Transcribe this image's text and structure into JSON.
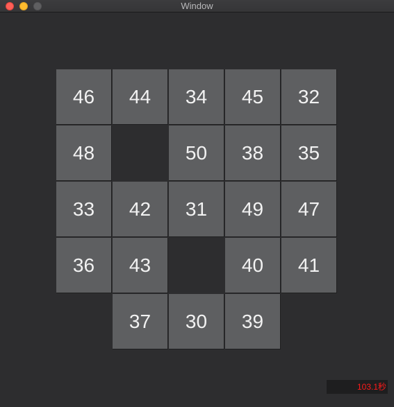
{
  "window": {
    "title": "Window"
  },
  "board": {
    "tiles": [
      {
        "label": "46",
        "row": 0,
        "col": 0
      },
      {
        "label": "44",
        "row": 0,
        "col": 1
      },
      {
        "label": "34",
        "row": 0,
        "col": 2
      },
      {
        "label": "45",
        "row": 0,
        "col": 3
      },
      {
        "label": "32",
        "row": 0,
        "col": 4
      },
      {
        "label": "48",
        "row": 1,
        "col": 0
      },
      {
        "label": "50",
        "row": 1,
        "col": 2
      },
      {
        "label": "38",
        "row": 1,
        "col": 3
      },
      {
        "label": "35",
        "row": 1,
        "col": 4
      },
      {
        "label": "33",
        "row": 2,
        "col": 0
      },
      {
        "label": "42",
        "row": 2,
        "col": 1
      },
      {
        "label": "31",
        "row": 2,
        "col": 2
      },
      {
        "label": "49",
        "row": 2,
        "col": 3
      },
      {
        "label": "47",
        "row": 2,
        "col": 4
      },
      {
        "label": "36",
        "row": 3,
        "col": 0
      },
      {
        "label": "43",
        "row": 3,
        "col": 1
      },
      {
        "label": "40",
        "row": 3,
        "col": 3
      },
      {
        "label": "41",
        "row": 3,
        "col": 4
      },
      {
        "label": "37",
        "row": 4,
        "col": 1
      },
      {
        "label": "30",
        "row": 4,
        "col": 2
      },
      {
        "label": "39",
        "row": 4,
        "col": 3
      }
    ]
  },
  "timer": {
    "value": "103.1秒"
  },
  "colors": {
    "background": "#2d2d2f",
    "tile": "#5e5f61",
    "tile_text": "#f2f2f2",
    "timer_text": "#ff1a1a"
  }
}
